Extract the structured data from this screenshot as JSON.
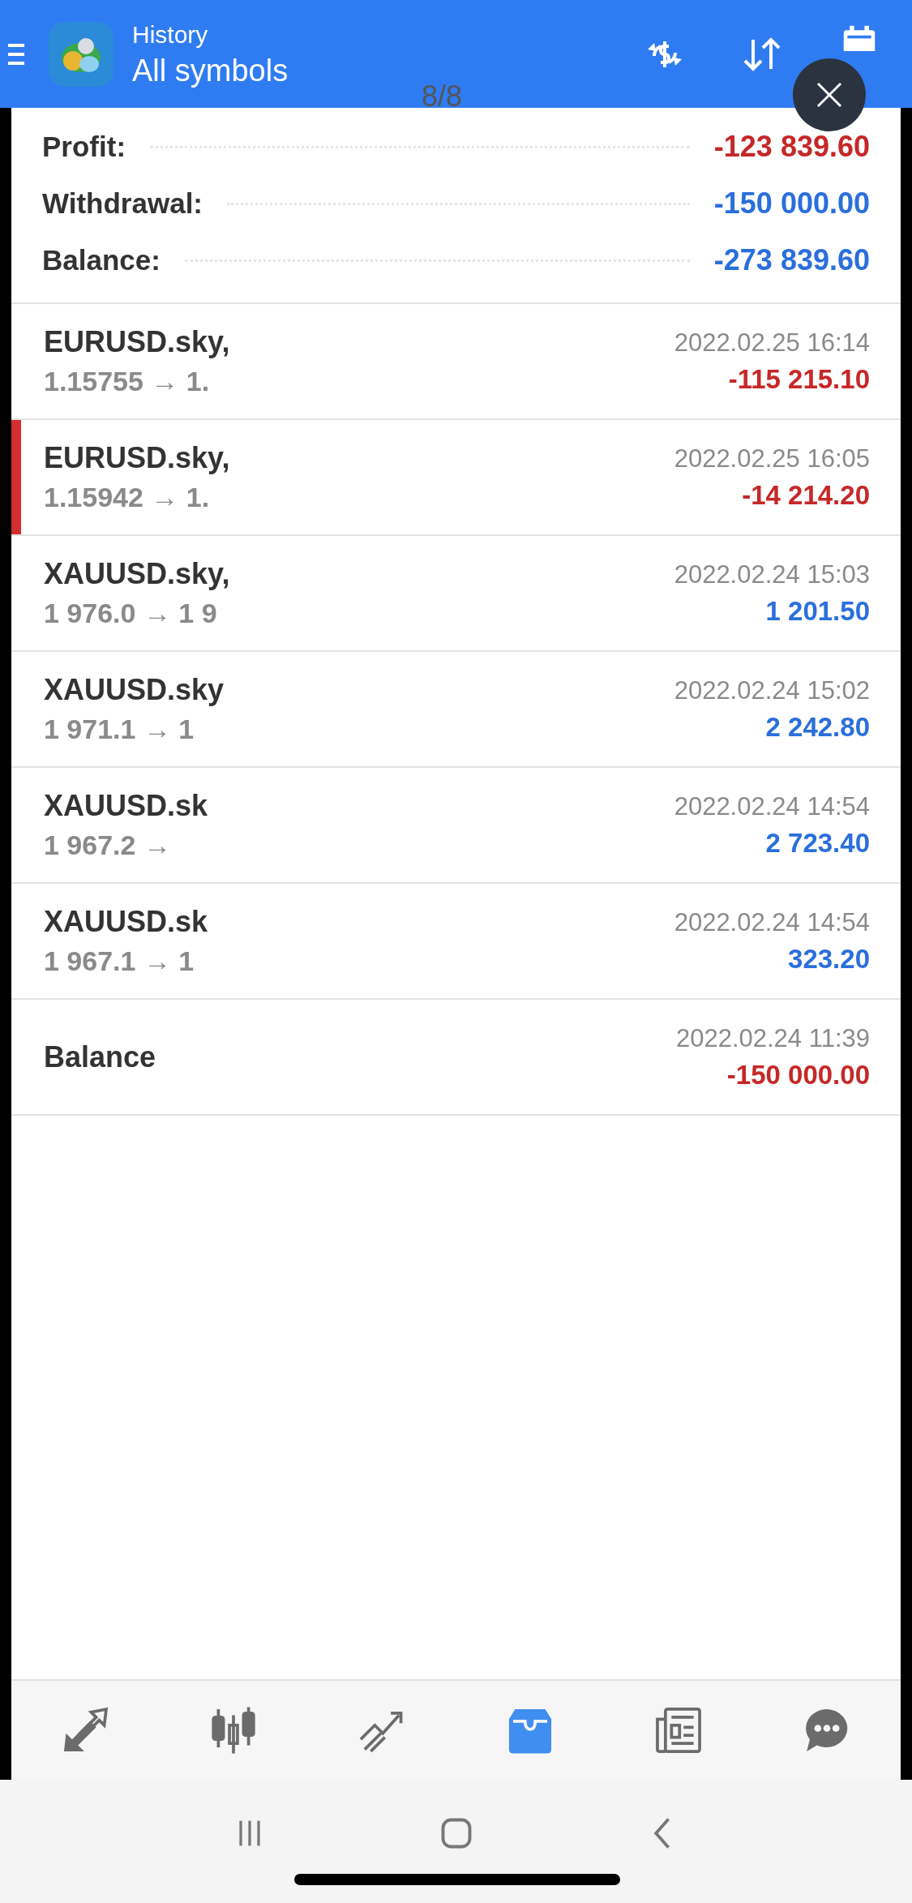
{
  "header": {
    "title": "History",
    "subtitle": "All symbols"
  },
  "viewer": {
    "counter": "8/8"
  },
  "summary": [
    {
      "label": "Profit:",
      "value": "-123 839.60",
      "color": "#c62828"
    },
    {
      "label": "Withdrawal:",
      "value": "-150 000.00",
      "color": "#2a6fdb"
    },
    {
      "label": "Balance:",
      "value": "-273 839.60",
      "color": "#2a6fdb"
    }
  ],
  "deals": [
    {
      "symbol": "EURUSD.sky,",
      "prices": "1.15755 → 1.",
      "time": "2022.02.25 16:14",
      "result": "-115 215.10",
      "color": "#c62828",
      "selected": false
    },
    {
      "symbol": "EURUSD.sky,",
      "prices": "1.15942 → 1.",
      "time": "2022.02.25 16:05",
      "result": "-14 214.20",
      "color": "#c62828",
      "selected": true
    },
    {
      "symbol": "XAUUSD.sky,",
      "prices": "1 976.0 → 1 9",
      "time": "2022.02.24 15:03",
      "result": "1 201.50",
      "color": "#2a6fdb",
      "selected": false
    },
    {
      "symbol": "XAUUSD.sky",
      "prices": "1 971.1 → 1",
      "time": "2022.02.24 15:02",
      "result": "2 242.80",
      "color": "#2a6fdb",
      "selected": false
    },
    {
      "symbol": "XAUUSD.sk",
      "prices": "1 967.2 →",
      "time": "2022.02.24 14:54",
      "result": "2 723.40",
      "color": "#2a6fdb",
      "selected": false
    },
    {
      "symbol": "XAUUSD.sk",
      "prices": "1 967.1 → 1",
      "time": "2022.02.24 14:54",
      "result": "323.20",
      "color": "#2a6fdb",
      "selected": false
    },
    {
      "symbol": "Balance",
      "time": "2022.02.24 11:39",
      "result": "-150 000.00",
      "color": "#c62828",
      "selected": false
    }
  ],
  "nav": [
    {
      "kind": "trade",
      "selected": false
    },
    {
      "kind": "chart",
      "selected": false
    },
    {
      "kind": "quotes",
      "selected": false
    },
    {
      "kind": "history",
      "selected": true
    },
    {
      "kind": "news",
      "selected": false
    },
    {
      "kind": "chat",
      "selected": false
    }
  ]
}
